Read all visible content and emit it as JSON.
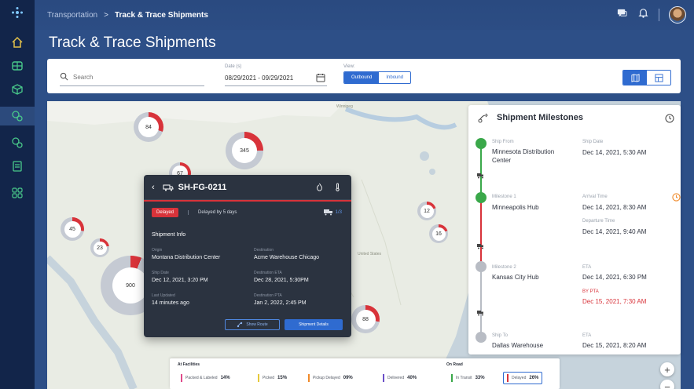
{
  "nav": {
    "breadcrumb_root": "Transportation",
    "breadcrumb_sep": ">",
    "breadcrumb_current": "Track & Trace Shipments"
  },
  "page_title": "Track & Trace Shipments",
  "filters": {
    "search_placeholder": "Search",
    "date_label": "Date (s)",
    "date_value": "08/29/2021 - 09/29/2021",
    "view_label": "View:",
    "outbound": "Outbound",
    "inbound": "Inbound"
  },
  "map": {
    "labels": [
      "Winnipeg",
      "United States"
    ],
    "clusters": [
      "84",
      "345",
      "67",
      "45",
      "23",
      "900",
      "12",
      "16",
      "88"
    ]
  },
  "popup": {
    "shipment_id": "SH-FG-0211",
    "status_badge": "Delayed",
    "delay_text": "Delayed by 5 days",
    "delay_count": "1/3",
    "section_title": "Shipment Info",
    "origin_label": "Origin",
    "origin_value": "Montana Distribution Center",
    "destination_label": "Destination",
    "destination_value": "Acme Warehouse Chicago",
    "ship_date_label": "Ship Date",
    "ship_date_value": "Dec 12, 2021, 3:20 PM",
    "dest_eta_label": "Destination ETA",
    "dest_eta_value": "Dec 28, 2021, 5:30PM",
    "last_updated_label": "Last Updated",
    "last_updated_value": "14 minutes ago",
    "dest_pta_label": "Destination PTA",
    "dest_pta_value": "Jan 2, 2022, 2:45 PM",
    "show_route": "Show Route",
    "shipment_details": "Shipment Details"
  },
  "milestones": {
    "title": "Shipment Milestones",
    "items": [
      {
        "label": "Ship From",
        "name": "Minnesota Distribution Center",
        "t1_label": "Ship Date",
        "t1_value": "Dec 14, 2021, 5:30 AM"
      },
      {
        "label": "Milestone 1",
        "name": "Minneapolis Hub",
        "t1_label": "Arrival Time",
        "t1_value": "Dec 14, 2021, 8:30 AM",
        "t2_label": "Departure Time",
        "t2_value": "Dec 14, 2021, 9:40 AM"
      },
      {
        "label": "Milestone 2",
        "name": "Kansas City Hub",
        "t1_label": "ETA",
        "t1_value": "Dec 14, 2021, 6:30 PM",
        "t2_label": "BY PTA",
        "t2_value": "Dec 15, 2021, 7:30 AM"
      },
      {
        "label": "Ship To",
        "name": "Dallas Warehouse",
        "t1_label": "ETA",
        "t1_value": "Dec 15, 2021, 8:20 AM"
      }
    ]
  },
  "legend": {
    "facilities_title": "At Facilities",
    "road_title": "On Road",
    "items": [
      {
        "label": "Packed & Labeled",
        "value": "14%",
        "color": "#e04a8a"
      },
      {
        "label": "Picked",
        "value": "15%",
        "color": "#e6c93a"
      },
      {
        "label": "Pickup Delayed",
        "value": "09%",
        "color": "#f08a2a"
      },
      {
        "label": "Delivered",
        "value": "40%",
        "color": "#6a4fc8"
      },
      {
        "label": "In Transit",
        "value": "33%",
        "color": "#3aa84a"
      },
      {
        "label": "Delayed",
        "value": "26%",
        "color": "#d8333a"
      }
    ]
  },
  "zoom": {
    "plus": "+",
    "minus": "−"
  },
  "colors": {
    "accent": "#2f6bd0",
    "delayed": "#d8333a",
    "ok": "#3aa84a",
    "header": "#2d4f87"
  }
}
